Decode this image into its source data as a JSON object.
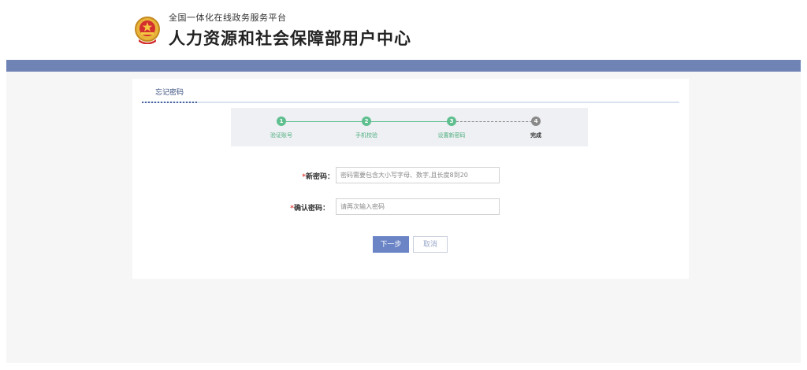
{
  "header": {
    "platform_name": "全国一体化在线政务服务平台",
    "center_title": "人力资源和社会保障部用户中心"
  },
  "tabs": [
    {
      "label": "忘记密码",
      "active": true
    }
  ],
  "steps": [
    {
      "number": "1",
      "label": "验证账号",
      "status": "done"
    },
    {
      "number": "2",
      "label": "手机校验",
      "status": "done"
    },
    {
      "number": "3",
      "label": "设置新密码",
      "status": "done"
    },
    {
      "number": "4",
      "label": "完成",
      "status": "todo"
    }
  ],
  "form": {
    "required_mark": "*",
    "new_password": {
      "label": "新密码：",
      "value": "",
      "placeholder": "密码需要包含大小写字母、数字,且长度8到20"
    },
    "confirm_password": {
      "label": "确认密码：",
      "value": "",
      "placeholder": "请再次输入密码"
    }
  },
  "buttons": {
    "next_label": "下一步",
    "cancel_label": "取消"
  },
  "colors": {
    "brand_bar": "#6f83b5",
    "step_done": "#5fbf8f",
    "step_todo": "#8a8a8a",
    "primary_button": "#6b84c6",
    "required": "#e0463f"
  }
}
